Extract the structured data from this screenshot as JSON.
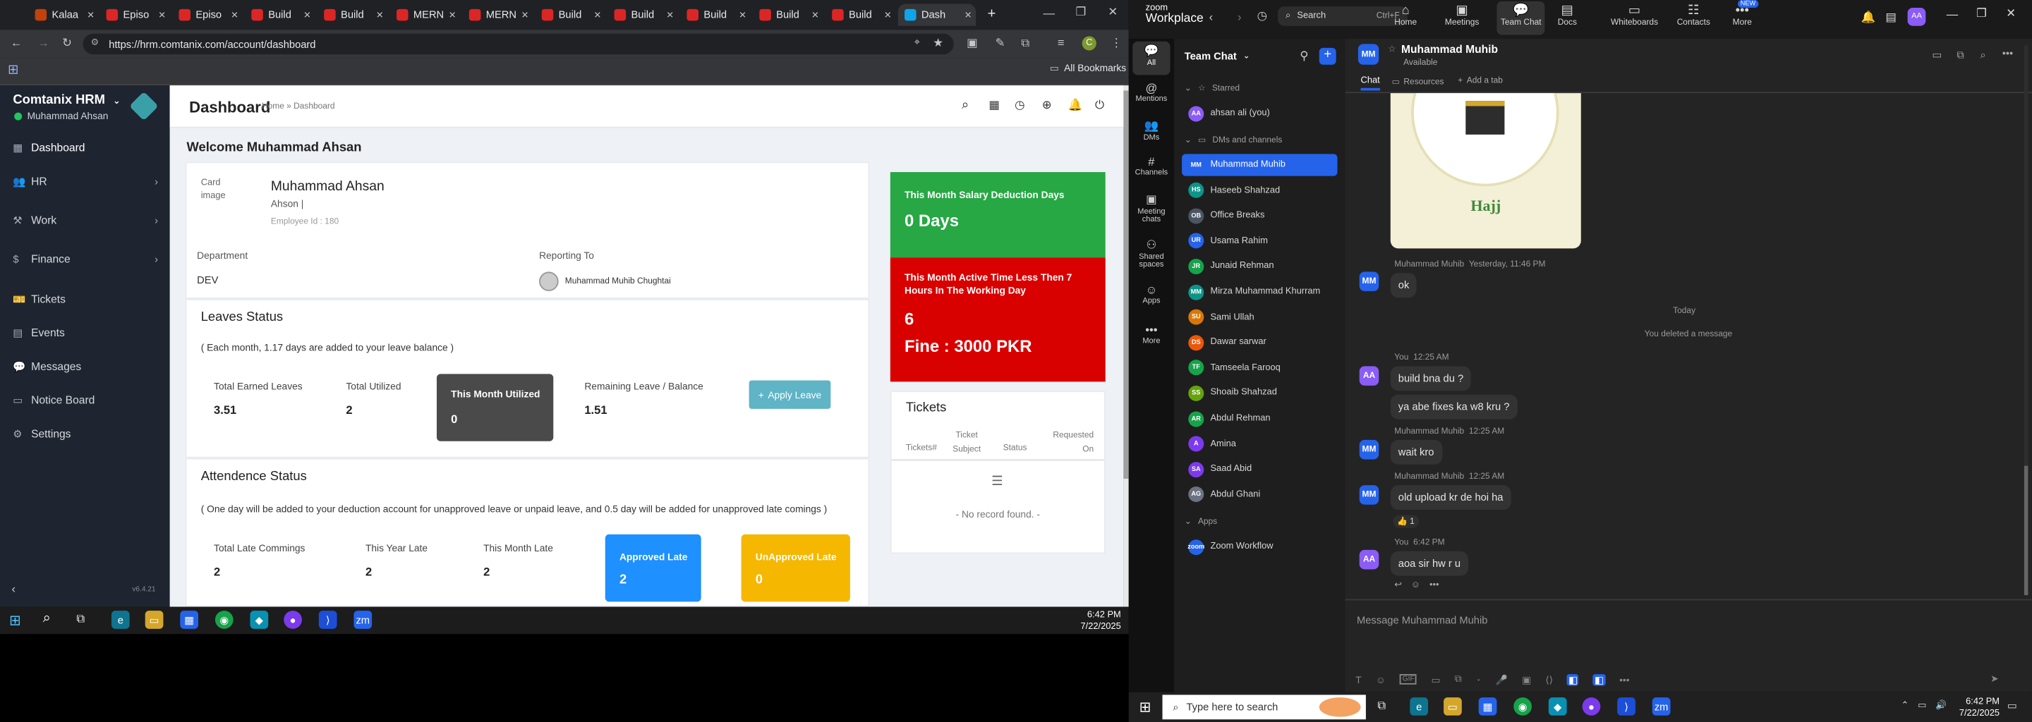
{
  "browser": {
    "tabs": [
      {
        "label": "Kalaa",
        "color": "#c2410c"
      },
      {
        "label": "Episo",
        "color": "#dc2626"
      },
      {
        "label": "Episo",
        "color": "#dc2626"
      },
      {
        "label": "Build",
        "color": "#dc2626"
      },
      {
        "label": "Build",
        "color": "#dc2626"
      },
      {
        "label": "MERN",
        "color": "#dc2626"
      },
      {
        "label": "MERN",
        "color": "#dc2626"
      },
      {
        "label": "Build",
        "color": "#dc2626"
      },
      {
        "label": "Build",
        "color": "#dc2626"
      },
      {
        "label": "Build",
        "color": "#dc2626"
      },
      {
        "label": "Build",
        "color": "#dc2626"
      },
      {
        "label": "Build",
        "color": "#dc2626"
      },
      {
        "label": "Dash",
        "color": "#0ea5e9"
      }
    ],
    "new_tab": "+",
    "url": "https://hrm.comtanix.com/account/dashboard",
    "bookmarks_label": "All Bookmarks",
    "profile_initial": "C"
  },
  "hrm": {
    "company": "Comtanix HRM",
    "user": "Muhammad Ahsan",
    "version": "v6.4.21",
    "nav": [
      {
        "label": "Dashboard",
        "icon": "dashboard-icon",
        "glyph": "▦",
        "chev": ""
      },
      {
        "label": "HR",
        "icon": "users-icon",
        "glyph": "👥",
        "chev": "›"
      },
      {
        "label": "Work",
        "icon": "work-icon",
        "glyph": "⚒",
        "chev": "›"
      },
      {
        "label": "Finance",
        "icon": "dollar-icon",
        "glyph": "$",
        "chev": "›"
      },
      {
        "label": "Tickets",
        "icon": "ticket-icon",
        "glyph": "🎫",
        "chev": ""
      },
      {
        "label": "Events",
        "icon": "calendar-icon",
        "glyph": "▤",
        "chev": ""
      },
      {
        "label": "Messages",
        "icon": "chat-icon",
        "glyph": "💬",
        "chev": ""
      },
      {
        "label": "Notice Board",
        "icon": "notice-icon",
        "glyph": "▭",
        "chev": ""
      },
      {
        "label": "Settings",
        "icon": "gear-icon",
        "glyph": "⚙",
        "chev": ""
      }
    ],
    "page_title": "Dashboard",
    "breadcrumb": "Home » Dashboard",
    "welcome": "Welcome Muhammad Ahsan",
    "profile": {
      "img_alt": "Card image",
      "name": "Muhammad Ahsan",
      "nick": "Ahson |",
      "emp_id": "Employee Id : 180",
      "dept_label": "Department",
      "dept": "DEV",
      "reporting_label": "Reporting To",
      "reporting": "Muhammad Muhib Chughtai"
    },
    "leaves": {
      "title": "Leaves Status",
      "note": "( Each month, 1.17 days are added to your leave balance )",
      "items": [
        {
          "label": "Total Earned Leaves",
          "value": "3.51"
        },
        {
          "label": "Total Utilized",
          "value": "2"
        },
        {
          "label": "This Month Utilized",
          "value": "0"
        },
        {
          "label": "Remaining Leave / Balance",
          "value": "1.51"
        }
      ],
      "apply": "Apply Leave"
    },
    "attendance": {
      "title": "Attendence Status",
      "note": "( One day will be added to your deduction account for unapproved leave or unpaid leave, and 0.5 day will be added for unapproved late comings )",
      "items": [
        {
          "label": "Total Late Commings",
          "value": "2"
        },
        {
          "label": "This Year Late",
          "value": "2"
        },
        {
          "label": "This Month Late",
          "value": "2"
        }
      ],
      "approved": {
        "label": "Approved Late",
        "value": "2"
      },
      "unapproved": {
        "label": "UnApproved Late",
        "value": "0"
      }
    },
    "salary": {
      "title": "This Month Salary Deduction Days",
      "value": "0 Days"
    },
    "active": {
      "title": "This Month Active Time Less Then 7 Hours In The Working Day",
      "value": "6",
      "fine": "Fine : 3000 PKR"
    },
    "tickets": {
      "title": "Tickets",
      "cols": [
        "Tickets#",
        "Ticket Subject",
        "Status",
        "Requested On"
      ],
      "empty": "- No record found. -"
    }
  },
  "taskbar_left": {
    "time": "6:42 PM",
    "date": "7/22/2025"
  },
  "zoom": {
    "brand_top": "zoom",
    "brand": "Workplace",
    "search": "Search",
    "search_shortcut": "Ctrl+F",
    "nav": [
      {
        "label": "Home",
        "icon": "home-icon",
        "glyph": "⌂"
      },
      {
        "label": "Meetings",
        "icon": "video-icon",
        "glyph": "▣"
      },
      {
        "label": "Team Chat",
        "icon": "chat-icon",
        "glyph": "💬"
      },
      {
        "label": "Docs",
        "icon": "doc-icon",
        "glyph": "▤"
      },
      {
        "label": "Whiteboards",
        "icon": "whiteboard-icon",
        "glyph": "▭"
      },
      {
        "label": "Contacts",
        "icon": "contacts-icon",
        "glyph": "☷"
      },
      {
        "label": "More",
        "icon": "more-icon",
        "glyph": "•••"
      }
    ],
    "new_badge": "NEW",
    "rail": [
      {
        "label": "All",
        "glyph": "💬"
      },
      {
        "label": "Mentions",
        "glyph": "@"
      },
      {
        "label": "DMs",
        "glyph": "👥"
      },
      {
        "label": "Channels",
        "glyph": "#"
      },
      {
        "label": "Meeting chats",
        "glyph": "▣"
      },
      {
        "label": "Shared spaces",
        "glyph": "⚇"
      },
      {
        "label": "Apps",
        "glyph": "☺"
      },
      {
        "label": "More",
        "glyph": "•••"
      }
    ],
    "panel_title": "Team Chat",
    "starred_label": "Starred",
    "starred": [
      {
        "name": "ahsan ali (you)",
        "initials": "AA",
        "color": "#8b5cf6"
      }
    ],
    "dms_label": "DMs and channels",
    "dms": [
      {
        "name": "Muhammad Muhib",
        "initials": "MM",
        "color": "#2563eb"
      },
      {
        "name": "Haseeb Shahzad",
        "initials": "HS",
        "color": "#0d9488"
      },
      {
        "name": "Office Breaks",
        "initials": "OB",
        "color": "#4b5563"
      },
      {
        "name": "Usama Rahim",
        "initials": "UR",
        "color": "#2563eb"
      },
      {
        "name": "Junaid Rehman",
        "initials": "JR",
        "color": "#16a34a"
      },
      {
        "name": "Mirza Muhammad Khurram",
        "initials": "MM",
        "color": "#0d9488"
      },
      {
        "name": "Sami Ullah",
        "initials": "SU",
        "color": "#d97706"
      },
      {
        "name": "Dawar sarwar",
        "initials": "DS",
        "color": "#ea580c"
      },
      {
        "name": "Tamseela Farooq",
        "initials": "TF",
        "color": "#16a34a"
      },
      {
        "name": "Shoaib Shahzad",
        "initials": "SS",
        "color": "#65a30d"
      },
      {
        "name": "Abdul Rehman",
        "initials": "AR",
        "color": "#16a34a"
      },
      {
        "name": "Amina",
        "initials": "A",
        "color": "#7c3aed"
      },
      {
        "name": "Saad Abid",
        "initials": "SA",
        "color": "#7c3aed"
      },
      {
        "name": "Abdul Ghani",
        "initials": "AG",
        "color": "#6b7280"
      }
    ],
    "apps_label": "Apps",
    "apps": [
      {
        "name": "Zoom Workflow",
        "initials": "zoom",
        "color": "#2563eb"
      }
    ],
    "chat_with": "Muhammad Muhib",
    "chat_status": "Available",
    "tabs": [
      "Chat",
      "Resources",
      "Add a tab"
    ],
    "hajj": "Hajj",
    "messages": [
      {
        "sender": "Muhammad Muhib",
        "time": "Yesterday, 11:46 PM",
        "initials": "MM",
        "text": "ok"
      },
      {
        "sender": "You",
        "time": "12:25 AM",
        "initials": "AA",
        "text": "build bna du  ?"
      },
      {
        "sender": "",
        "time": "",
        "initials": "",
        "text": "ya abe fixes ka w8 kru ?"
      },
      {
        "sender": "Muhammad Muhib",
        "time": "12:25 AM",
        "initials": "MM",
        "text": "wait kro"
      },
      {
        "sender": "Muhammad Muhib",
        "time": "12:25 AM",
        "initials": "MM",
        "text": "old upload kr de hoi ha"
      },
      {
        "sender": "You",
        "time": "6:42 PM",
        "initials": "AA",
        "text": "aoa sir hw r u"
      }
    ],
    "reaction": "👍 1",
    "today": "Today",
    "deleted": "You deleted a message",
    "composer_placeholder": "Message Muhammad Muhib"
  },
  "taskbar_right": {
    "search": "Type here to search",
    "time": "6:42 PM",
    "date": "7/22/2025"
  }
}
